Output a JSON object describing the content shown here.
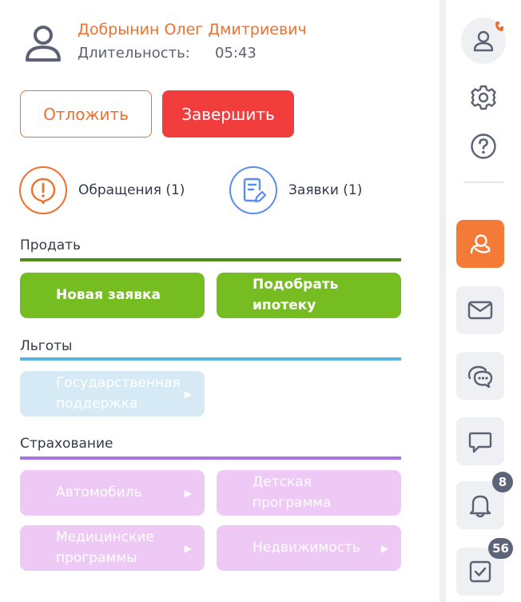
{
  "caller": {
    "name": "Добрынин Олег Дмитриевич",
    "duration_label": "Длительность:",
    "duration_value": "05:43"
  },
  "actions": {
    "defer_label": "Отложить",
    "finish_label": "Завершить"
  },
  "counters": {
    "requests_label": "Обращения (1)",
    "applications_label": "Заявки (1)"
  },
  "sections": {
    "sell": {
      "title": "Продать",
      "color": "#4f8f17",
      "items": [
        "Новая заявка",
        "Подобрать\nипотеку"
      ]
    },
    "benefits": {
      "title": "Льготы",
      "color": "#5ab4e0",
      "items": [
        "Государственная\nподдержка"
      ]
    },
    "insurance": {
      "title": "Страхование",
      "color": "#a673e8",
      "items": [
        "Автомобиль",
        "Детская\nпрограмма",
        "Медицинские\nпрограммы",
        "Недвижимость"
      ]
    }
  },
  "rail": {
    "notifications_badge": "8",
    "tasks_badge": "56"
  },
  "colors": {
    "accent_orange": "#f06f2d",
    "finish_red": "#f23d3d",
    "tile_green": "#76bd22",
    "tile_blue": "#d5eaf4",
    "tile_purple": "#efc9f6",
    "rail_active": "#f47a37"
  },
  "icons": {
    "caller_avatar": "user-icon",
    "requests": "alert-bubble-icon",
    "applications": "document-edit-icon",
    "rail": [
      "user-phone-icon",
      "gear-icon",
      "help-icon",
      "operator-icon",
      "mail-icon",
      "chat-group-icon",
      "chat-icon",
      "bell-icon",
      "checkbox-icon"
    ]
  }
}
